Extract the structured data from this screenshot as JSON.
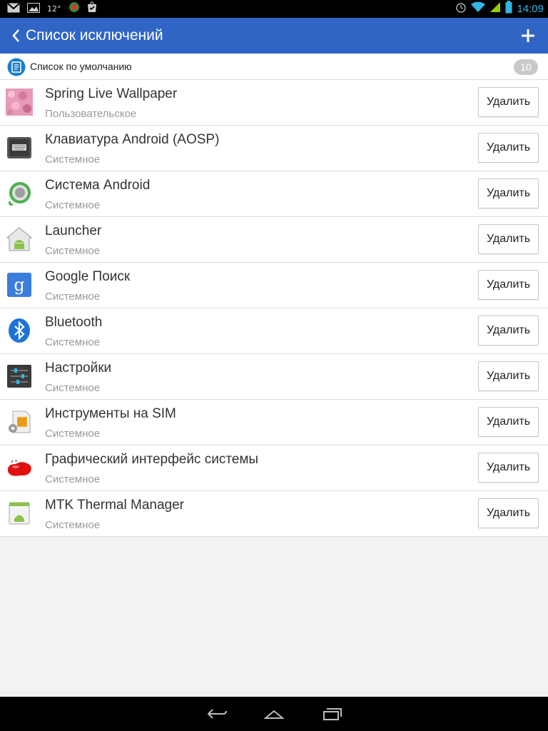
{
  "status_bar": {
    "temperature": "12°",
    "time": "14:09",
    "left_icons": [
      "gmail-icon",
      "gallery-icon",
      "temperature",
      "app-icon",
      "bag-check-icon"
    ],
    "right_icons": [
      "alarm-icon",
      "wifi-icon",
      "signal-icon",
      "battery-icon"
    ]
  },
  "app_bar": {
    "title": "Список исключений",
    "color": "#3065c5"
  },
  "default_list": {
    "label": "Список по умолчанию",
    "count": "10"
  },
  "apps": [
    {
      "name": "Spring Live Wallpaper",
      "type": "Пользовательское",
      "icon": "spring-wallpaper-icon",
      "action": "Удалить"
    },
    {
      "name": "Клавиатура Android (AOSP)",
      "type": "Системное",
      "icon": "keyboard-icon",
      "action": "Удалить"
    },
    {
      "name": "Система Android",
      "type": "Системное",
      "icon": "android-system-icon",
      "action": "Удалить"
    },
    {
      "name": "Launcher",
      "type": "Системное",
      "icon": "launcher-icon",
      "action": "Удалить"
    },
    {
      "name": "Google Поиск",
      "type": "Системное",
      "icon": "google-search-icon",
      "action": "Удалить"
    },
    {
      "name": "Bluetooth",
      "type": "Системное",
      "icon": "bluetooth-icon",
      "action": "Удалить"
    },
    {
      "name": "Настройки",
      "type": "Системное",
      "icon": "settings-icon",
      "action": "Удалить"
    },
    {
      "name": "Инструменты на SIM",
      "type": "Системное",
      "icon": "sim-toolkit-icon",
      "action": "Удалить"
    },
    {
      "name": "Графический интерфейс системы",
      "type": "Системное",
      "icon": "system-ui-icon",
      "action": "Удалить"
    },
    {
      "name": "MTK Thermal Manager",
      "type": "Системное",
      "icon": "thermal-manager-icon",
      "action": "Удалить"
    }
  ],
  "nav_bar": {
    "buttons": [
      "back-nav-icon",
      "home-nav-icon",
      "recents-nav-icon"
    ]
  }
}
